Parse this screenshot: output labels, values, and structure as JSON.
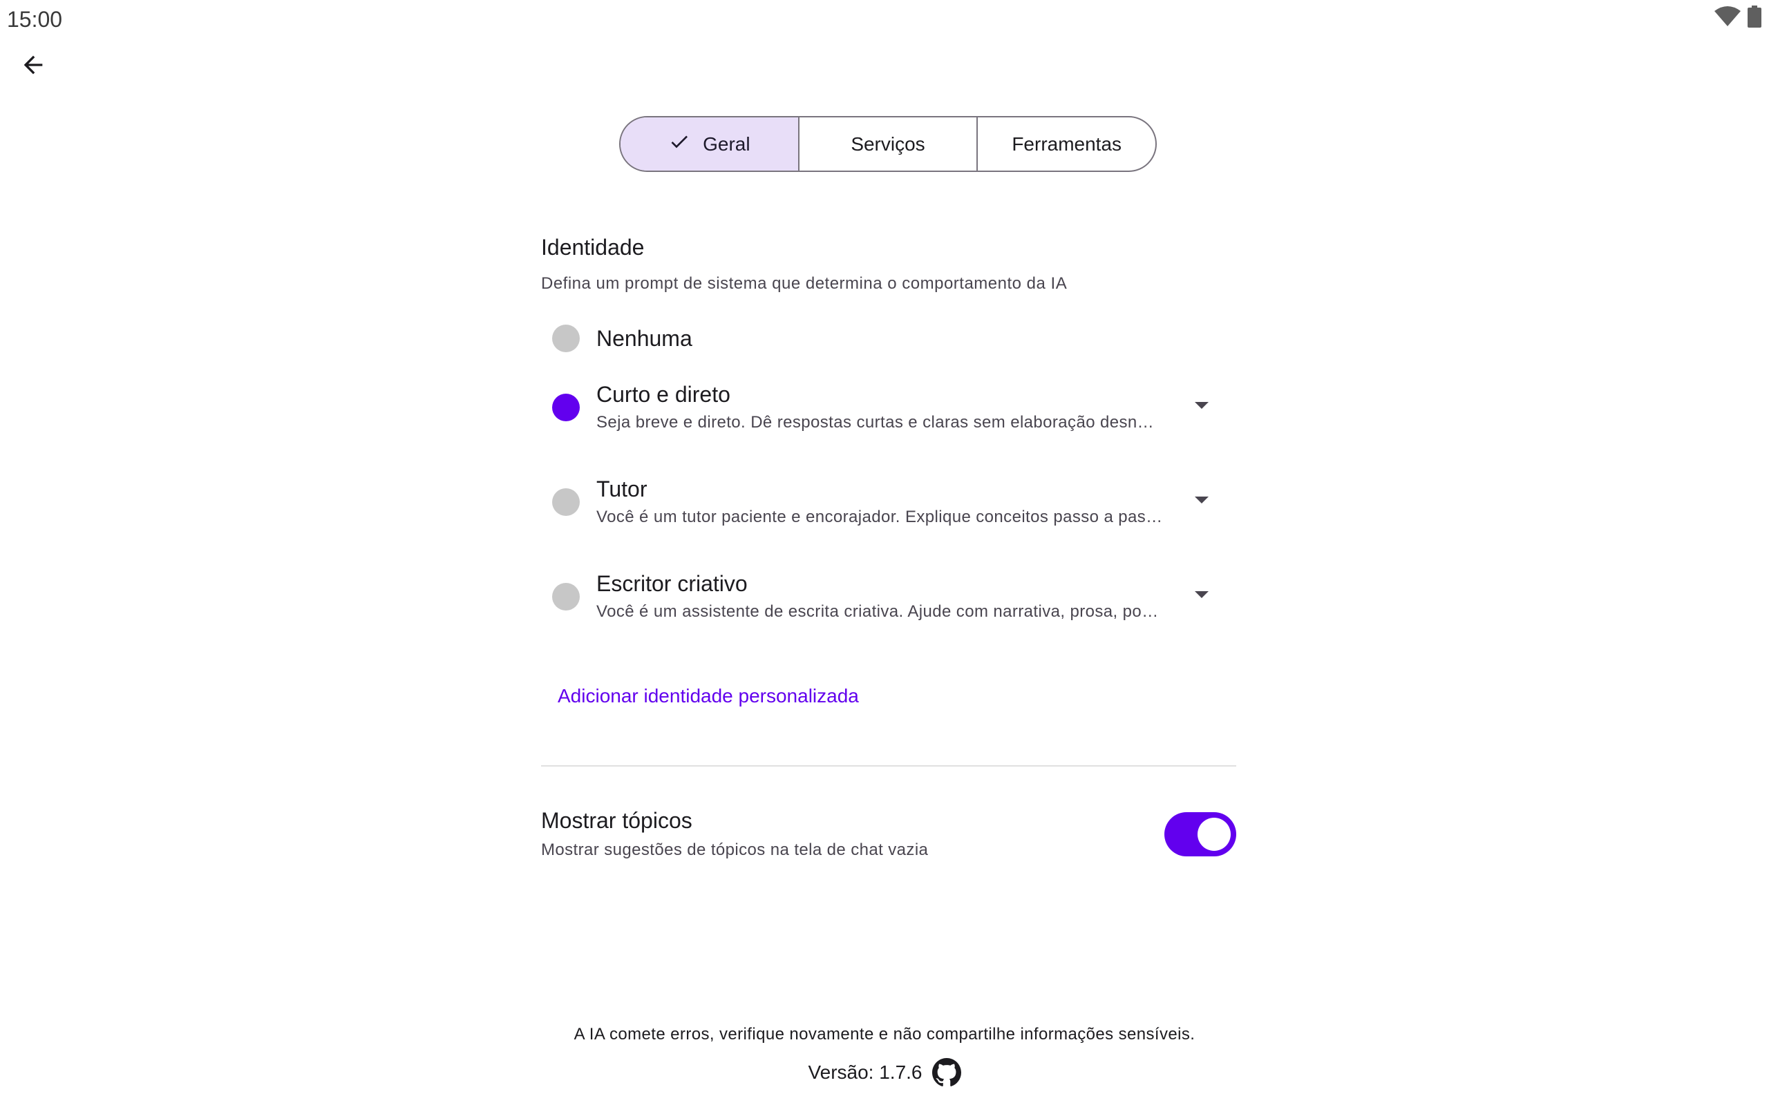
{
  "status_bar": {
    "time": "15:00",
    "icons": [
      "wifi-icon",
      "battery-icon"
    ]
  },
  "nav": {
    "back_icon": "arrow-back-icon"
  },
  "tabs": [
    {
      "label": "Geral",
      "selected": true
    },
    {
      "label": "Serviços",
      "selected": false
    },
    {
      "label": "Ferramentas",
      "selected": false
    }
  ],
  "identity": {
    "title": "Identidade",
    "subtitle": "Defina um prompt de sistema que determina o comportamento da IA",
    "options": [
      {
        "label": "Nenhuma",
        "description": "",
        "selected": false
      },
      {
        "label": "Curto e direto",
        "description": "Seja breve e direto. Dê respostas curtas e claras sem elaboração desnecessária.",
        "selected": true
      },
      {
        "label": "Tutor",
        "description": "Você é um tutor paciente e encorajador. Explique conceitos passo a passo.",
        "selected": false
      },
      {
        "label": "Escritor criativo",
        "description": "Você é um assistente de escrita criativa. Ajude com narrativa, prosa, poesia.",
        "selected": false
      }
    ],
    "add_button_label": "Adicionar identidade personalizada"
  },
  "topics": {
    "title": "Mostrar tópicos",
    "subtitle": "Mostrar sugestões de tópicos na tela de chat vazia",
    "enabled": true
  },
  "footer": {
    "disclaimer": "A IA comete erros, verifique novamente e não compartilhe informações sensíveis.",
    "version_label": "Versão: 1.7.6",
    "link_icon": "github-icon"
  },
  "colors": {
    "accent": "#6200ee",
    "selected_tab_bg": "#e8def8",
    "radio_unselected": "#c7c7c7"
  }
}
